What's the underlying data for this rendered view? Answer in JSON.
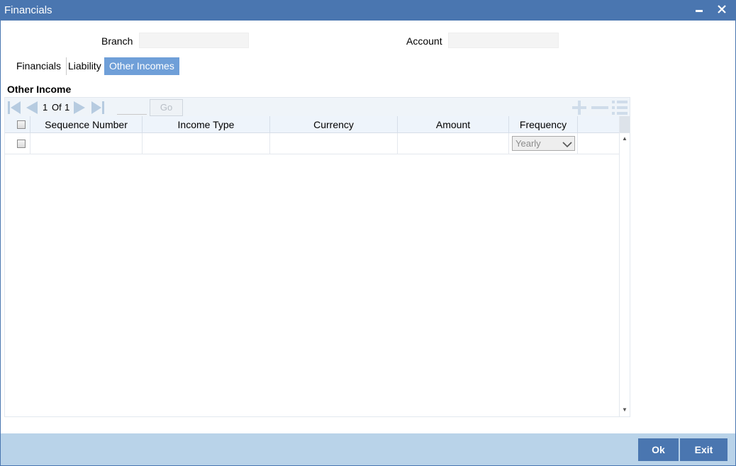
{
  "window": {
    "title": "Financials",
    "minimize_label": "—",
    "close_label": "✕"
  },
  "header": {
    "branch_label": "Branch",
    "branch_value": "",
    "account_label": "Account",
    "account_value": ""
  },
  "tabs": [
    {
      "label": "Financials",
      "active": false
    },
    {
      "label": "Liability",
      "active": false
    },
    {
      "label": "Other Incomes",
      "active": true
    }
  ],
  "section": {
    "title": "Other Income"
  },
  "pager": {
    "current": "1",
    "of_label": "Of",
    "total": "1",
    "go_label": "Go",
    "page_input": ""
  },
  "grid": {
    "columns": [
      "Sequence Number",
      "Income Type",
      "Currency",
      "Amount",
      "Frequency"
    ],
    "rows": [
      {
        "sequence_number": "",
        "income_type": "",
        "currency": "",
        "amount": "",
        "frequency": "Yearly"
      }
    ]
  },
  "footer": {
    "ok_label": "Ok",
    "exit_label": "Exit"
  },
  "colors": {
    "titlebar": "#4a76b0",
    "active_tab": "#6f9fd8",
    "footer": "#b9d3e9",
    "button": "#4a76b0"
  },
  "icons": [
    "first-page-icon",
    "previous-page-icon",
    "next-page-icon",
    "last-page-icon",
    "add-row-icon",
    "delete-row-icon",
    "single-view-icon",
    "chevron-down-icon",
    "minimize-icon",
    "close-icon"
  ]
}
